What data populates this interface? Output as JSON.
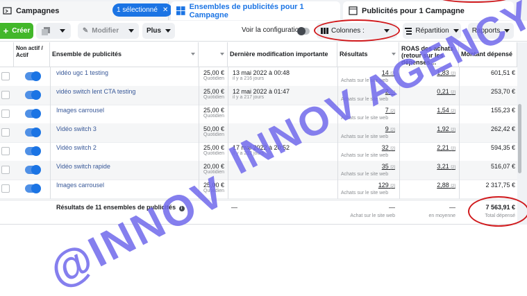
{
  "tabs": {
    "campaigns": "Campagnes",
    "selected_badge": "1 sélectionné",
    "ad_sets": "Ensembles de publicités pour 1 Campagne",
    "ads": "Publicités pour 1 Campagne"
  },
  "toolbar": {
    "create": "Créer",
    "edit": "Modifier",
    "more": "Plus",
    "view_config": "Voir la configuration",
    "columns": "Colonnes :",
    "breakdown": "Répartition",
    "reports": "Rapports"
  },
  "columns": {
    "status": "Non actif / Actif",
    "ad_set": "Ensemble de publicités",
    "last_change": "Dernière modification importante",
    "results": "Résultats",
    "roas": "ROAS des achats (retour sur les dépenses…",
    "spent": "Montant dépensé"
  },
  "rows": [
    {
      "name": "vidéo ugc 1 testing",
      "budget": "25,00 €",
      "budget_type": "Quotidien",
      "change": "13 mai 2022 à 00:48",
      "change_ago": "il y a 216 jours",
      "result": "14",
      "result_type": "Achats sur le site web",
      "roas": "1,83",
      "spent": "601,51 €"
    },
    {
      "name": "vidéo switch lent CTA testing",
      "budget": "25,00 €",
      "budget_type": "Quotidien",
      "change": "12 mai 2022 à 01:47",
      "change_ago": "il y a 217 jours",
      "result": "2",
      "result_type": "Achats sur le site web",
      "roas": "0,21",
      "spent": "253,70 €"
    },
    {
      "name": "Images carrousel",
      "budget": "25,00 €",
      "budget_type": "Quotidien",
      "change": "",
      "change_ago": "",
      "result": "7",
      "result_type": "Achats sur le site web",
      "roas": "1,54",
      "spent": "155,23 €"
    },
    {
      "name": "Vidéo switch 3",
      "budget": "50,00 €",
      "budget_type": "Quotidien",
      "change": "",
      "change_ago": "",
      "result": "9",
      "result_type": "Achats sur le site web",
      "roas": "1,92",
      "spent": "262,42 €"
    },
    {
      "name": "Vidéo switch 2",
      "budget": "25,00 €",
      "budget_type": "Quotidien",
      "change": "17 mai 2022 à 20:52",
      "change_ago": "il y a 212 jours",
      "result": "32",
      "result_type": "Achats sur le site web",
      "roas": "2,21",
      "spent": "594,35 €"
    },
    {
      "name": "Vidéo switch rapide",
      "budget": "20,00 €",
      "budget_type": "Quotidien",
      "change": "",
      "change_ago": "",
      "result": "35",
      "result_type": "Achats sur le site web",
      "roas": "3,21",
      "spent": "516,07 €"
    },
    {
      "name": "Images carrousel",
      "budget": "25,00 €",
      "budget_type": "Quotidien",
      "change": "",
      "change_ago": "",
      "result": "129",
      "result_type": "Achats sur le site web",
      "roas": "2,88",
      "spent": "2 317,75 €"
    }
  ],
  "total": {
    "label": "Résultats de 11 ensembles de publicités",
    "dash": "—",
    "result_type": "Achat sur le site web",
    "roas_type": "en moyenne",
    "spent": "7 563,91 €",
    "spent_label": "Total dépensé"
  },
  "watermark": {
    "line1": "INNOV AGENCY",
    "line2": "@INNOV"
  },
  "footnote_mark": "[2]"
}
